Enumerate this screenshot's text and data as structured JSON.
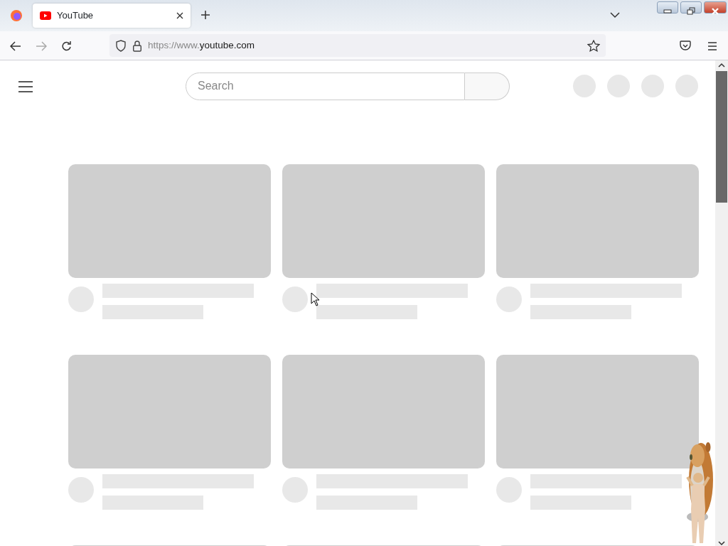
{
  "browser": {
    "tabs": [
      {
        "title": "YouTube",
        "selected": true
      }
    ],
    "address": {
      "prefix": "https://www.",
      "domain": "youtube.com"
    }
  },
  "page": {
    "search": {
      "placeholder": "Search"
    },
    "header_placeholders": [
      {
        "kind": "circle"
      },
      {
        "kind": "circle"
      },
      {
        "kind": "circle"
      },
      {
        "kind": "circle"
      }
    ],
    "video_placeholders": [
      {
        "kind": "skeleton"
      },
      {
        "kind": "skeleton"
      },
      {
        "kind": "skeleton"
      },
      {
        "kind": "skeleton"
      },
      {
        "kind": "skeleton"
      },
      {
        "kind": "skeleton"
      },
      {
        "kind": "thumbnail"
      },
      {
        "kind": "thumbnail"
      },
      {
        "kind": "thumbnail"
      }
    ]
  }
}
